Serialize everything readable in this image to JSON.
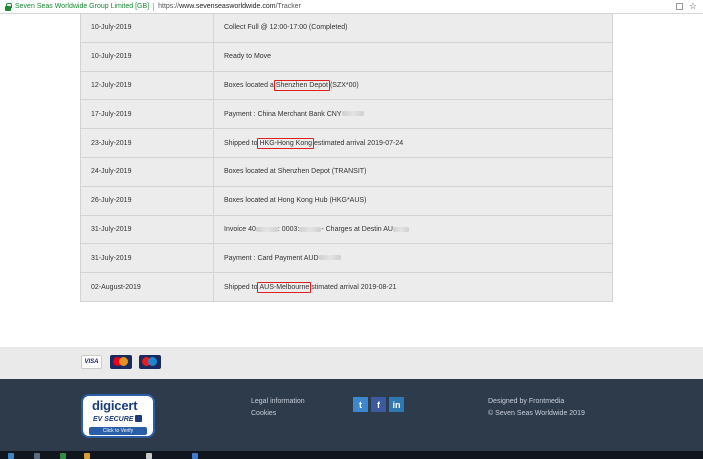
{
  "browser": {
    "site_name": "Seven Seas Worldwide Group Limited [GB]",
    "url_prefix": "https://",
    "url_domain": "www.sevenseasworldwide.com",
    "url_path": "/Tracker",
    "star_glyph": "☆"
  },
  "tracking": {
    "rows": [
      {
        "date": "10-July-2019",
        "pre": "Collect Full @ 12:00-17:00 (Completed)",
        "hl": "",
        "post": "",
        "blur": false
      },
      {
        "date": "10-July-2019",
        "pre": "Ready to Move",
        "hl": "",
        "post": "",
        "blur": false
      },
      {
        "date": "12-July-2019",
        "pre": "Boxes located a",
        "hl": "Shenzhen Depot",
        "post": "(SZX*00)",
        "blur": false
      },
      {
        "date": "17-July-2019",
        "pre": "Payment : China Merchant Bank CNY",
        "hl": "",
        "post": "",
        "blur": true
      },
      {
        "date": "23-July-2019",
        "pre": "Shipped to",
        "hl": "HKG-Hong Kong",
        "post": "estimated arrival 2019-07-24",
        "blur": false
      },
      {
        "date": "24-July-2019",
        "pre": "Boxes located at Shenzhen Depot (TRANSIT)",
        "hl": "",
        "post": "",
        "blur": false
      },
      {
        "date": "26-July-2019",
        "pre": "Boxes located at Hong Kong Hub (HKG*AUS)",
        "hl": "",
        "post": "",
        "blur": false
      },
      {
        "date": "31-July-2019",
        "pre": "Invoice 40",
        "hl": "",
        "post": "",
        "blur": false,
        "invoice": {
          "mid": ": 0003:",
          "tail": "- Charges at Destin AU"
        }
      },
      {
        "date": "31-July-2019",
        "pre": "Payment : Card Payment AUD",
        "hl": "",
        "post": "",
        "blur": true
      },
      {
        "date": "02-August-2019",
        "pre": "Shipped to",
        "hl": "AUS-Melbourne",
        "post": "stimated arrival 2019-08-21",
        "blur": false
      }
    ]
  },
  "payments": {
    "visa": "VISA"
  },
  "footer": {
    "legal": "Legal information",
    "cookies": "Cookies",
    "designed_by": "Designed by Frontmedia",
    "copyright": "© Seven Seas Worldwide 2019",
    "digicert_logo": "digicert",
    "digicert_ev": "EV SECURE",
    "digicert_click": "Click to Verify",
    "social": {
      "twitter": "t",
      "facebook": "f",
      "linkedin": "in"
    }
  },
  "colors": {
    "highlight": "#e02020",
    "footer_bg": "#2e3b4b",
    "row_bg": "#ececec",
    "secure_green": "#1a8a34"
  }
}
